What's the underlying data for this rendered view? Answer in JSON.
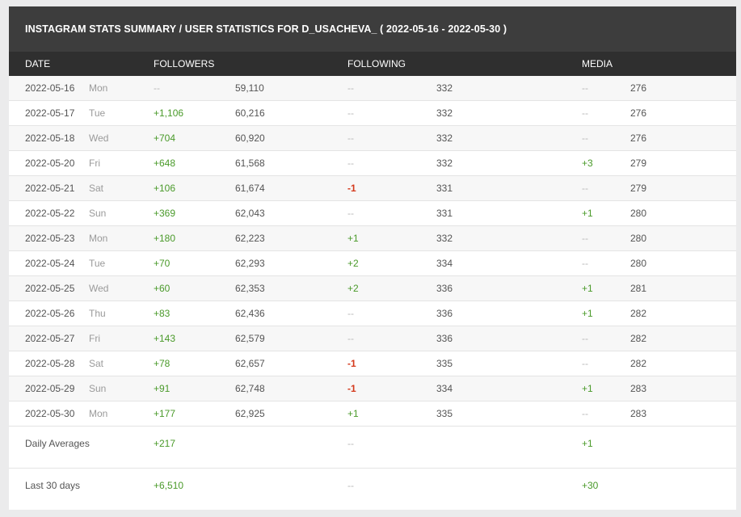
{
  "title": "INSTAGRAM STATS SUMMARY / USER STATISTICS FOR D_USACHEVA_ ( 2022-05-16 - 2022-05-30 )",
  "columns": {
    "date": "DATE",
    "followers": "FOLLOWERS",
    "following": "FOLLOWING",
    "media": "MEDIA"
  },
  "colors": {
    "positive": "#4a9a2a",
    "negative": "#d4391c",
    "neutral": "#b8b8b8",
    "header_bg": "#2f2f2f",
    "title_bg": "#3d3d3d"
  },
  "rows": [
    {
      "date": "2022-05-16",
      "day": "Mon",
      "followers_delta": "--",
      "followers": "59,110",
      "following_delta": "--",
      "following": "332",
      "media_delta": "--",
      "media": "276"
    },
    {
      "date": "2022-05-17",
      "day": "Tue",
      "followers_delta": "+1,106",
      "followers": "60,216",
      "following_delta": "--",
      "following": "332",
      "media_delta": "--",
      "media": "276"
    },
    {
      "date": "2022-05-18",
      "day": "Wed",
      "followers_delta": "+704",
      "followers": "60,920",
      "following_delta": "--",
      "following": "332",
      "media_delta": "--",
      "media": "276"
    },
    {
      "date": "2022-05-20",
      "day": "Fri",
      "followers_delta": "+648",
      "followers": "61,568",
      "following_delta": "--",
      "following": "332",
      "media_delta": "+3",
      "media": "279"
    },
    {
      "date": "2022-05-21",
      "day": "Sat",
      "followers_delta": "+106",
      "followers": "61,674",
      "following_delta": "-1",
      "following": "331",
      "media_delta": "--",
      "media": "279"
    },
    {
      "date": "2022-05-22",
      "day": "Sun",
      "followers_delta": "+369",
      "followers": "62,043",
      "following_delta": "--",
      "following": "331",
      "media_delta": "+1",
      "media": "280"
    },
    {
      "date": "2022-05-23",
      "day": "Mon",
      "followers_delta": "+180",
      "followers": "62,223",
      "following_delta": "+1",
      "following": "332",
      "media_delta": "--",
      "media": "280"
    },
    {
      "date": "2022-05-24",
      "day": "Tue",
      "followers_delta": "+70",
      "followers": "62,293",
      "following_delta": "+2",
      "following": "334",
      "media_delta": "--",
      "media": "280"
    },
    {
      "date": "2022-05-25",
      "day": "Wed",
      "followers_delta": "+60",
      "followers": "62,353",
      "following_delta": "+2",
      "following": "336",
      "media_delta": "+1",
      "media": "281"
    },
    {
      "date": "2022-05-26",
      "day": "Thu",
      "followers_delta": "+83",
      "followers": "62,436",
      "following_delta": "--",
      "following": "336",
      "media_delta": "+1",
      "media": "282"
    },
    {
      "date": "2022-05-27",
      "day": "Fri",
      "followers_delta": "+143",
      "followers": "62,579",
      "following_delta": "--",
      "following": "336",
      "media_delta": "--",
      "media": "282"
    },
    {
      "date": "2022-05-28",
      "day": "Sat",
      "followers_delta": "+78",
      "followers": "62,657",
      "following_delta": "-1",
      "following": "335",
      "media_delta": "--",
      "media": "282"
    },
    {
      "date": "2022-05-29",
      "day": "Sun",
      "followers_delta": "+91",
      "followers": "62,748",
      "following_delta": "-1",
      "following": "334",
      "media_delta": "+1",
      "media": "283"
    },
    {
      "date": "2022-05-30",
      "day": "Mon",
      "followers_delta": "+177",
      "followers": "62,925",
      "following_delta": "+1",
      "following": "335",
      "media_delta": "--",
      "media": "283"
    }
  ],
  "summary": [
    {
      "label": "Daily Averages",
      "followers": "+217",
      "following": "--",
      "media": "+1"
    },
    {
      "label": "Last 30 days",
      "followers": "+6,510",
      "following": "--",
      "media": "+30"
    }
  ]
}
